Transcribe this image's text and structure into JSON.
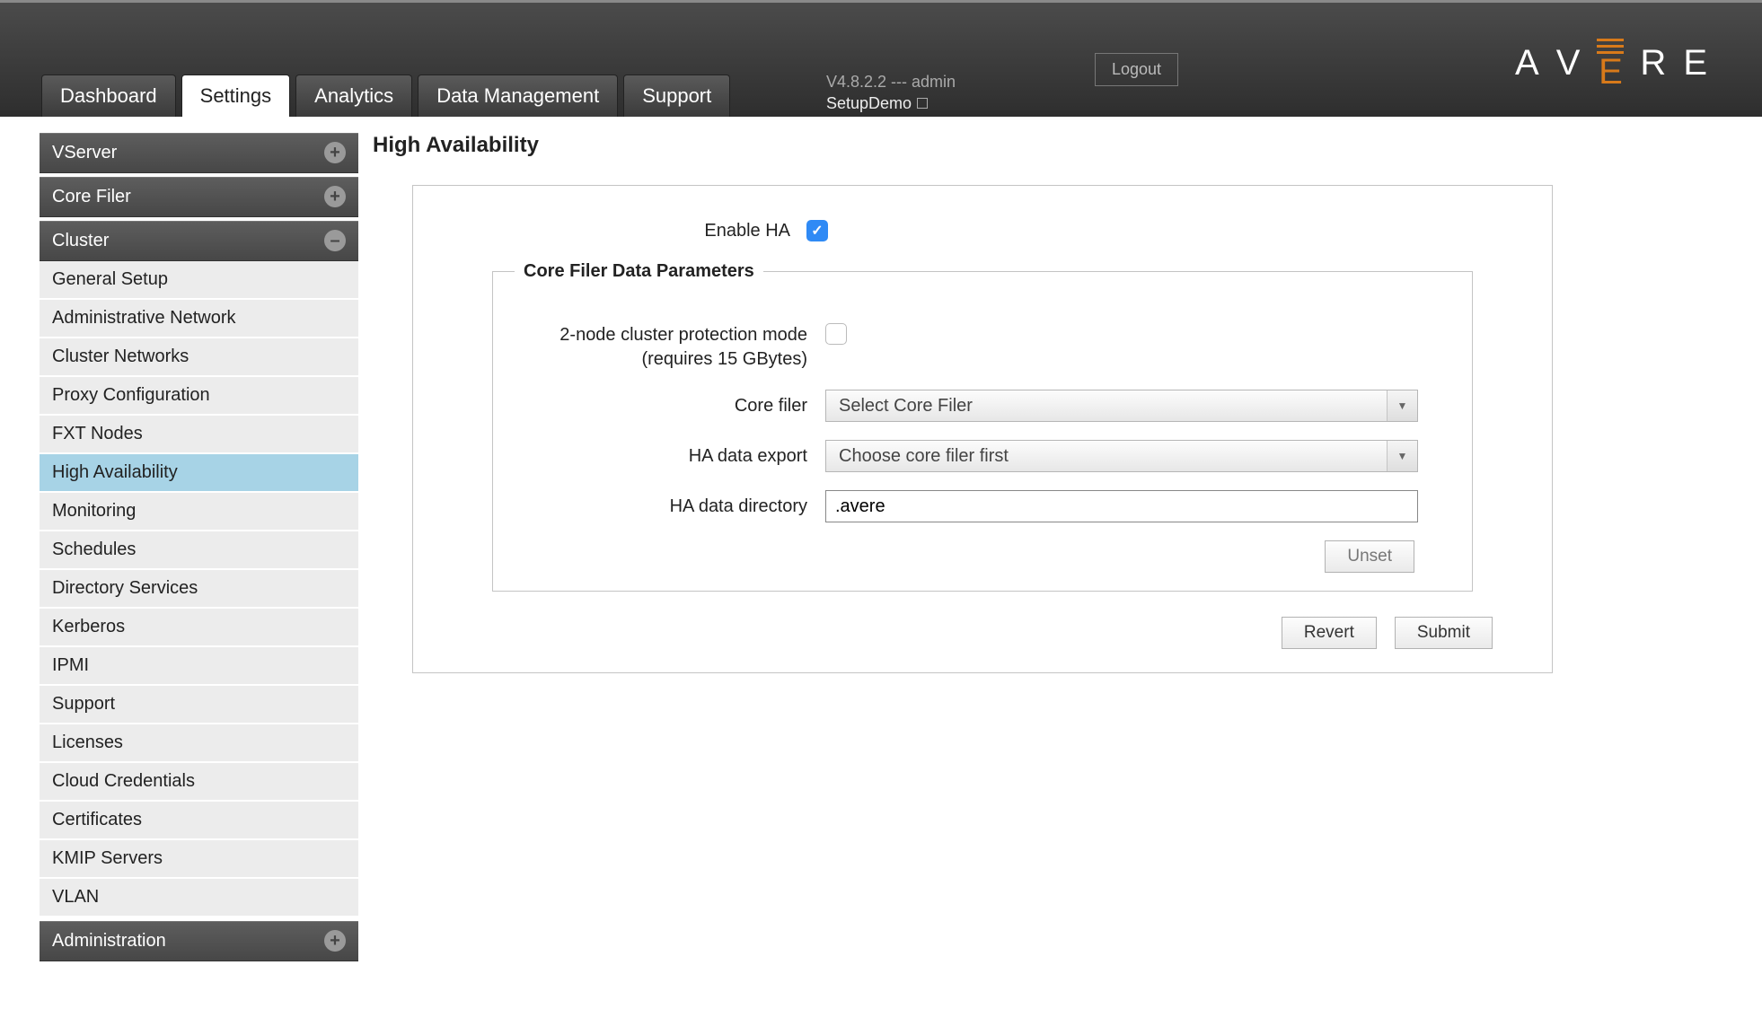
{
  "header": {
    "logout": "Logout",
    "brand_letters": [
      "A",
      "V",
      "E",
      "R",
      "E"
    ],
    "version_line": "V4.8.2.2 --- admin",
    "cluster_line": "SetupDemo"
  },
  "tabs": [
    {
      "label": "Dashboard",
      "active": false
    },
    {
      "label": "Settings",
      "active": true
    },
    {
      "label": "Analytics",
      "active": false
    },
    {
      "label": "Data Management",
      "active": false
    },
    {
      "label": "Support",
      "active": false
    }
  ],
  "sidebar": {
    "sections": [
      {
        "title": "VServer",
        "expanded": false,
        "items": []
      },
      {
        "title": "Core Filer",
        "expanded": false,
        "items": []
      },
      {
        "title": "Cluster",
        "expanded": true,
        "items": [
          {
            "label": "General Setup",
            "active": false
          },
          {
            "label": "Administrative Network",
            "active": false
          },
          {
            "label": "Cluster Networks",
            "active": false
          },
          {
            "label": "Proxy Configuration",
            "active": false
          },
          {
            "label": "FXT Nodes",
            "active": false
          },
          {
            "label": "High Availability",
            "active": true
          },
          {
            "label": "Monitoring",
            "active": false
          },
          {
            "label": "Schedules",
            "active": false
          },
          {
            "label": "Directory Services",
            "active": false
          },
          {
            "label": "Kerberos",
            "active": false
          },
          {
            "label": "IPMI",
            "active": false
          },
          {
            "label": "Support",
            "active": false
          },
          {
            "label": "Licenses",
            "active": false
          },
          {
            "label": "Cloud Credentials",
            "active": false
          },
          {
            "label": "Certificates",
            "active": false
          },
          {
            "label": "KMIP Servers",
            "active": false
          },
          {
            "label": "VLAN",
            "active": false
          }
        ]
      },
      {
        "title": "Administration",
        "expanded": false,
        "items": []
      }
    ]
  },
  "page": {
    "title": "High Availability",
    "enable_ha_label": "Enable HA",
    "enable_ha_checked": true,
    "fieldset_legend": "Core Filer Data Parameters",
    "two_node_label": "2-node cluster protection mode (requires 15 GBytes)",
    "two_node_checked": false,
    "core_filer_label": "Core filer",
    "core_filer_value": "Select Core Filer",
    "ha_export_label": "HA data export",
    "ha_export_value": "Choose core filer first",
    "ha_dir_label": "HA data directory",
    "ha_dir_value": ".avere",
    "unset_label": "Unset",
    "revert_label": "Revert",
    "submit_label": "Submit"
  }
}
